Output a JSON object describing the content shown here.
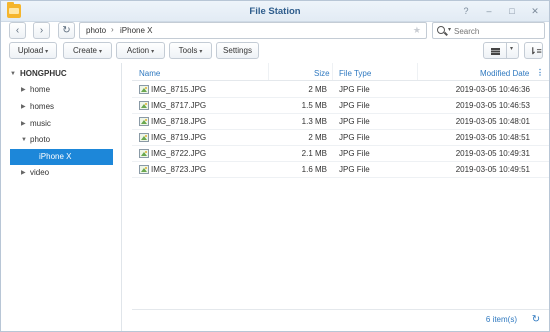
{
  "window": {
    "title": "File Station",
    "controls": [
      "?",
      "–",
      "□",
      "✕"
    ]
  },
  "nav": {
    "back_label": "‹",
    "forward_label": "›",
    "refresh_label": "↻",
    "breadcrumb": [
      "photo",
      "iPhone X"
    ],
    "breadcrumb_separator": "›",
    "favorite_label": "★",
    "search_placeholder": "Search"
  },
  "toolbar": {
    "upload_label": "Upload",
    "create_label": "Create",
    "action_label": "Action",
    "tools_label": "Tools",
    "settings_label": "Settings",
    "caret": "▾",
    "sort_label": "⇂≡"
  },
  "sidebar": {
    "root": {
      "label": "HONGPHUC",
      "arrow": "▼"
    },
    "items": [
      {
        "label": "home",
        "arrow": "▶"
      },
      {
        "label": "homes",
        "arrow": "▶"
      },
      {
        "label": "music",
        "arrow": "▶"
      },
      {
        "label": "photo",
        "arrow": "▼"
      },
      {
        "label": "iPhone X",
        "arrow": ""
      },
      {
        "label": "video",
        "arrow": "▶"
      }
    ]
  },
  "table": {
    "columns": {
      "name": "Name",
      "size": "Size",
      "type": "File Type",
      "modified": "Modified Date",
      "more": "⋮"
    },
    "rows": [
      {
        "name": "IMG_8715.JPG",
        "size": "2 MB",
        "type": "JPG File",
        "modified": "2019-03-05 10:46:36"
      },
      {
        "name": "IMG_8717.JPG",
        "size": "1.5 MB",
        "type": "JPG File",
        "modified": "2019-03-05 10:46:53"
      },
      {
        "name": "IMG_8718.JPG",
        "size": "1.3 MB",
        "type": "JPG File",
        "modified": "2019-03-05 10:48:01"
      },
      {
        "name": "IMG_8719.JPG",
        "size": "2 MB",
        "type": "JPG File",
        "modified": "2019-03-05 10:48:51"
      },
      {
        "name": "IMG_8722.JPG",
        "size": "2.1 MB",
        "type": "JPG File",
        "modified": "2019-03-05 10:49:31"
      },
      {
        "name": "IMG_8723.JPG",
        "size": "1.6 MB",
        "type": "JPG File",
        "modified": "2019-03-05 10:49:51"
      }
    ]
  },
  "footer": {
    "count": "6 item(s)",
    "refresh_label": "↻"
  },
  "colors": {
    "accent": "#2f79c0",
    "selection": "#1d87d9",
    "folder": "#f5b52c"
  }
}
